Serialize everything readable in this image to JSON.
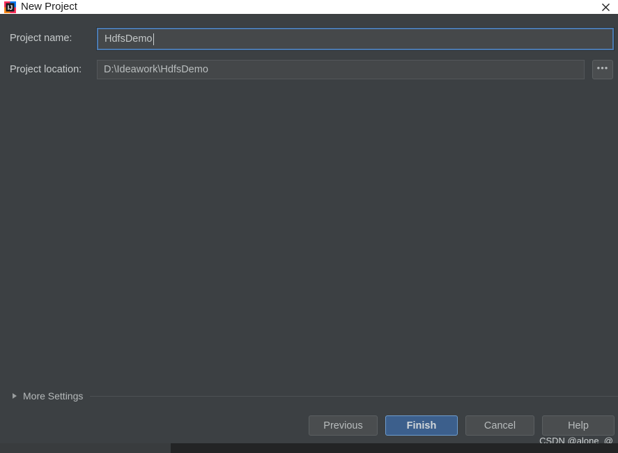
{
  "window": {
    "title": "New Project",
    "app_icon": "intellij-idea-icon",
    "close_label": "✕"
  },
  "form": {
    "project_name": {
      "label": "Project name:",
      "value": "HdfsDemo",
      "placeholder": "",
      "focused": true
    },
    "project_location": {
      "label": "Project location:",
      "value": "D:\\Ideawork\\HdfsDemo",
      "placeholder": "",
      "browse_label": "•••"
    }
  },
  "more_settings": {
    "label": "More Settings",
    "expanded": false,
    "arrow_icon": "triangle-right-icon"
  },
  "buttons": {
    "previous": "Previous",
    "finish": "Finish",
    "cancel": "Cancel",
    "help": "Help"
  },
  "watermark": {
    "text": "CSDN @alone_@"
  },
  "colors": {
    "dialog_background": "#3c4043",
    "titlebar_background": "#ffffff",
    "accent_focus_border": "#4b7ab0",
    "primary_button_fill": "#3c5f8c",
    "primary_button_border": "#6e9dcf",
    "button_fill": "#4a4d4f",
    "text_primary": "#c8cccd",
    "field_fill": "#444749"
  }
}
